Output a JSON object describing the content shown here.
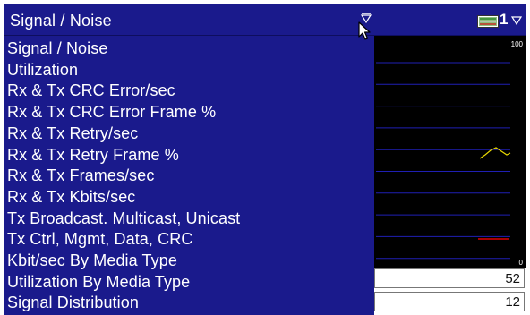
{
  "header": {
    "title": "Signal / Noise",
    "chart_number": "1"
  },
  "menu": {
    "items": [
      {
        "label": "Signal / Noise"
      },
      {
        "label": "Utilization"
      },
      {
        "label": "Rx & Tx CRC Error/sec"
      },
      {
        "label": "Rx & Tx CRC Error Frame %"
      },
      {
        "label": "Rx & Tx Retry/sec"
      },
      {
        "label": "Rx & Tx Retry Frame %"
      },
      {
        "label": "Rx & Tx Frames/sec"
      },
      {
        "label": "Rx & Tx Kbits/sec"
      },
      {
        "label": "Tx Broadcast. Multicast, Unicast"
      },
      {
        "label": "Tx Ctrl, Mgmt, Data, CRC"
      },
      {
        "label": "Kbit/sec By Media Type"
      },
      {
        "label": "Utilization By Media Type"
      },
      {
        "label": "Signal Distribution"
      }
    ]
  },
  "graph": {
    "y_max_label": "100",
    "y_min_label": "0",
    "colors": {
      "background": "#000000",
      "gridline": "#1f1fb4",
      "signal": "#e8d800",
      "noise": "#e00000"
    }
  },
  "readout": {
    "values": [
      "52",
      "12"
    ]
  },
  "colors": {
    "menu_background": "#1a1a8c",
    "menu_text": "#ffffff"
  }
}
